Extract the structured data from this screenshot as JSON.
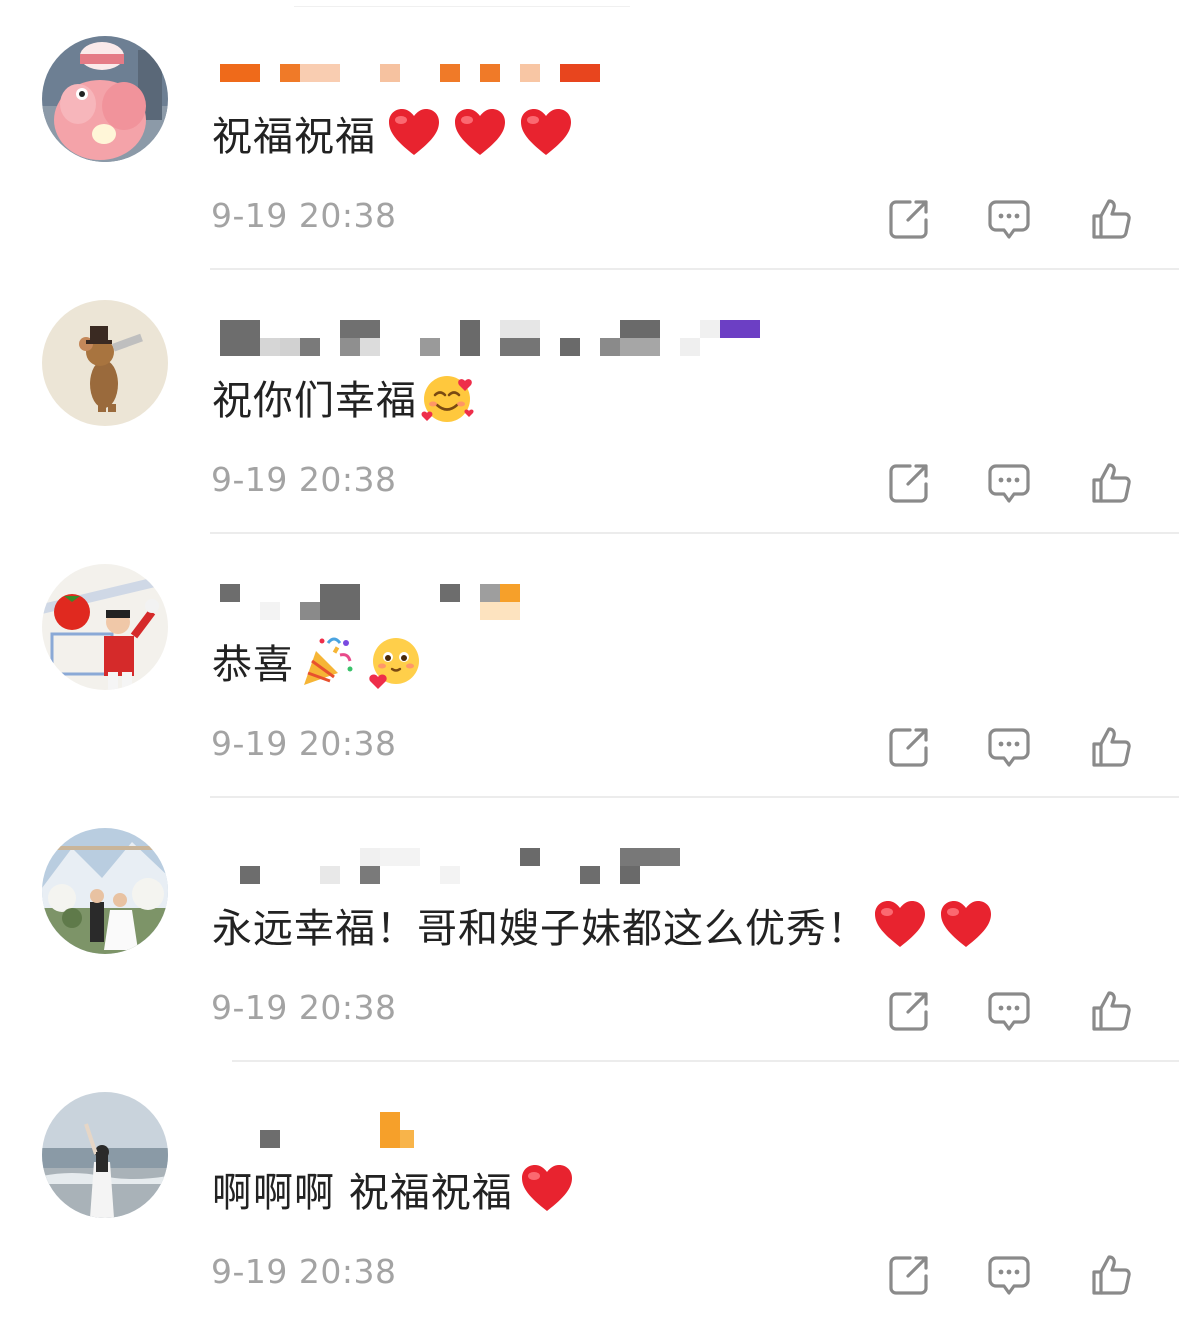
{
  "comments": [
    {
      "username_masked": true,
      "text": "祝福祝福",
      "emojis": [
        "red-heart",
        "red-heart",
        "red-heart"
      ],
      "time": "9-19 20:38"
    },
    {
      "username_masked": true,
      "text": "祝你们幸福",
      "emojis": [
        "smiling-face-with-hearts"
      ],
      "time": "9-19 20:38"
    },
    {
      "username_masked": true,
      "text": "恭喜",
      "emojis": [
        "party-popper",
        "cute-face-with-heart"
      ],
      "time": "9-19 20:38"
    },
    {
      "username_masked": true,
      "text": "永远幸福！哥和嫂子妹都这么优秀！",
      "emojis": [
        "red-heart",
        "red-heart"
      ],
      "time": "9-19 20:38"
    },
    {
      "username_masked": true,
      "text": "啊啊啊 祝福祝福",
      "emojis": [
        "red-heart"
      ],
      "time": "9-19 20:38"
    }
  ],
  "icons": {
    "share": "share-icon",
    "reply": "comment-icon",
    "like": "thumbs-up-icon"
  },
  "colors": {
    "text": "#222222",
    "meta": "#a3a3a3",
    "icon": "#8a8a8a",
    "heart": "#e8232f",
    "separator": "#ececec"
  }
}
